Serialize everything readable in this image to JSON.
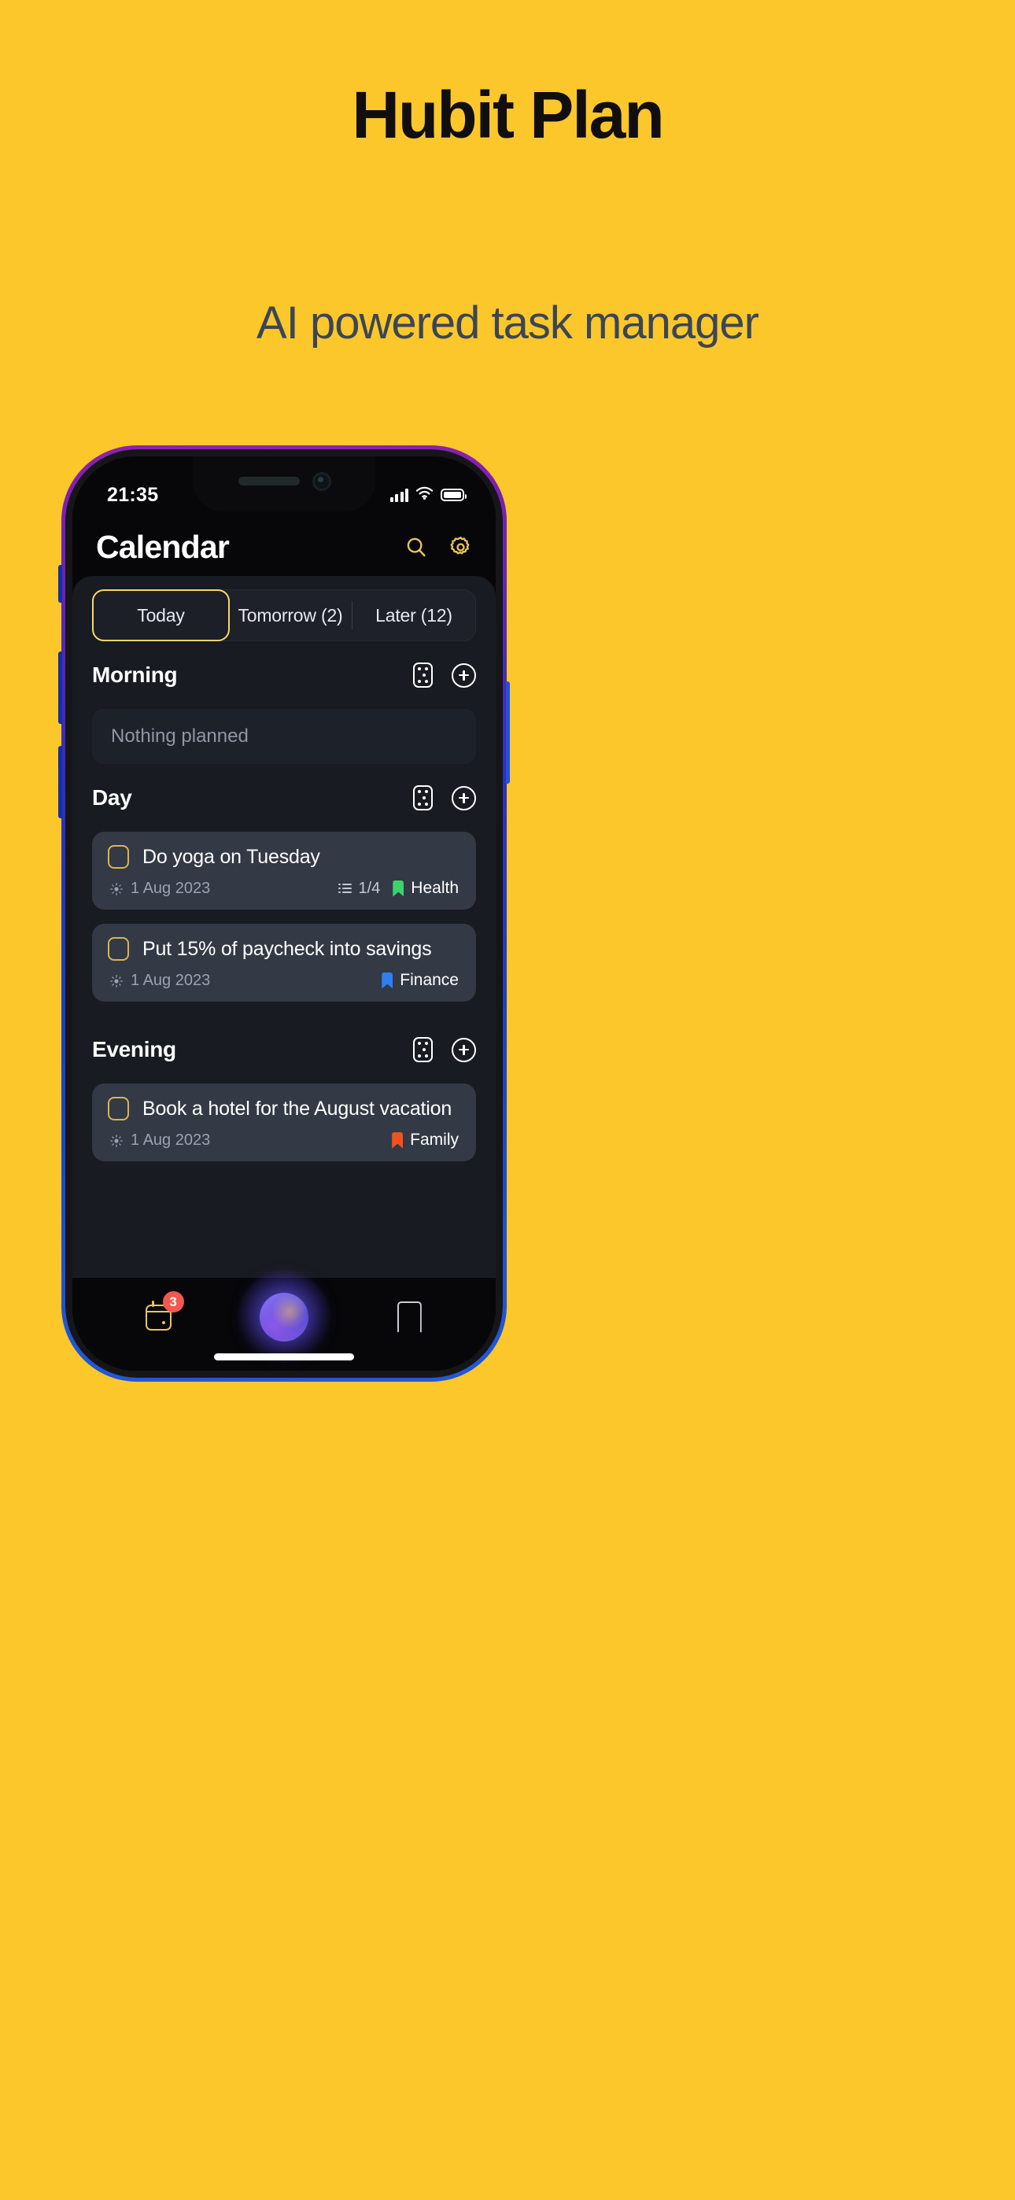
{
  "promo": {
    "title": "Hubit Plan",
    "subtitle": "AI powered task manager",
    "background": "#FBC72B",
    "title_color": "#110E10",
    "subtitle_color": "#3B4654"
  },
  "status_bar": {
    "time": "21:35",
    "signal_icon": "cellular-bars-icon",
    "wifi_icon": "wifi-icon",
    "battery_icon": "battery-full-icon"
  },
  "header": {
    "title": "Calendar",
    "search_icon": "search-icon",
    "settings_icon": "gear-icon",
    "accent": "#E7C65C"
  },
  "tabs": [
    {
      "label": "Today",
      "active": true
    },
    {
      "label": "Tomorrow  (2)",
      "active": false
    },
    {
      "label": "Later (12)",
      "active": false
    }
  ],
  "sections": [
    {
      "title": "Morning",
      "shuffle_icon": "dice-icon",
      "add_icon": "plus-circle-icon",
      "empty_text": "Nothing planned",
      "tasks": []
    },
    {
      "title": "Day",
      "shuffle_icon": "dice-icon",
      "add_icon": "plus-circle-icon",
      "empty_text": "",
      "tasks": [
        {
          "name": "Do yoga on Tuesday",
          "date_icon": "sun-icon",
          "date": "1 Aug 2023",
          "subtask_icon": "checklist-icon",
          "subtasks": "1/4",
          "tag": "Health",
          "tag_color": "#3DD36B"
        },
        {
          "name": "Put 15% of paycheck into savings",
          "date_icon": "sun-icon",
          "date": "1 Aug 2023",
          "subtask_icon": "",
          "subtasks": "",
          "tag": "Finance",
          "tag_color": "#2F7FF0"
        }
      ]
    },
    {
      "title": "Evening",
      "shuffle_icon": "dice-icon",
      "add_icon": "plus-circle-icon",
      "empty_text": "",
      "tasks": [
        {
          "name": "Book a hotel for the August vacation",
          "date_icon": "sun-icon",
          "date": "1 Aug 2023",
          "subtask_icon": "",
          "subtasks": "",
          "tag": "Family",
          "tag_color": "#F4511E"
        }
      ]
    }
  ],
  "bottom_nav": {
    "calendar_icon": "calendar-icon",
    "calendar_badge": "3",
    "badge_color": "#F2584F",
    "ai_orb_icon": "ai-orb-icon",
    "bookmark_icon": "bookmark-icon"
  }
}
